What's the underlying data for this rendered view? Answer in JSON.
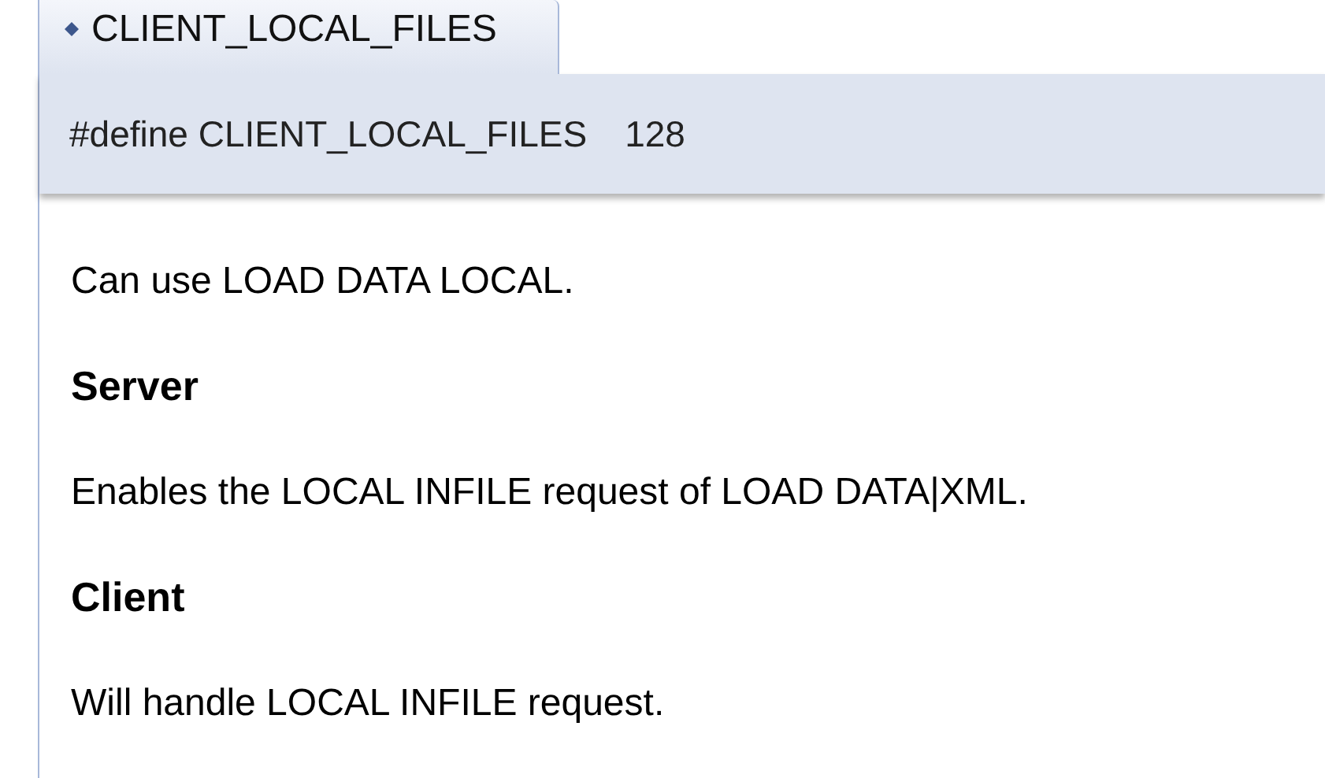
{
  "tab": {
    "title": "CLIENT_LOCAL_FILES"
  },
  "prototype": {
    "declaration": "#define CLIENT_LOCAL_FILES",
    "value": "128"
  },
  "description": [
    {
      "kind": "para",
      "text": "Can use LOAD DATA LOCAL."
    },
    {
      "kind": "heading",
      "text": "Server"
    },
    {
      "kind": "para",
      "text": "Enables the LOCAL INFILE request of LOAD DATA|XML."
    },
    {
      "kind": "heading",
      "text": "Client"
    },
    {
      "kind": "para",
      "text": "Will handle LOCAL INFILE request."
    }
  ]
}
